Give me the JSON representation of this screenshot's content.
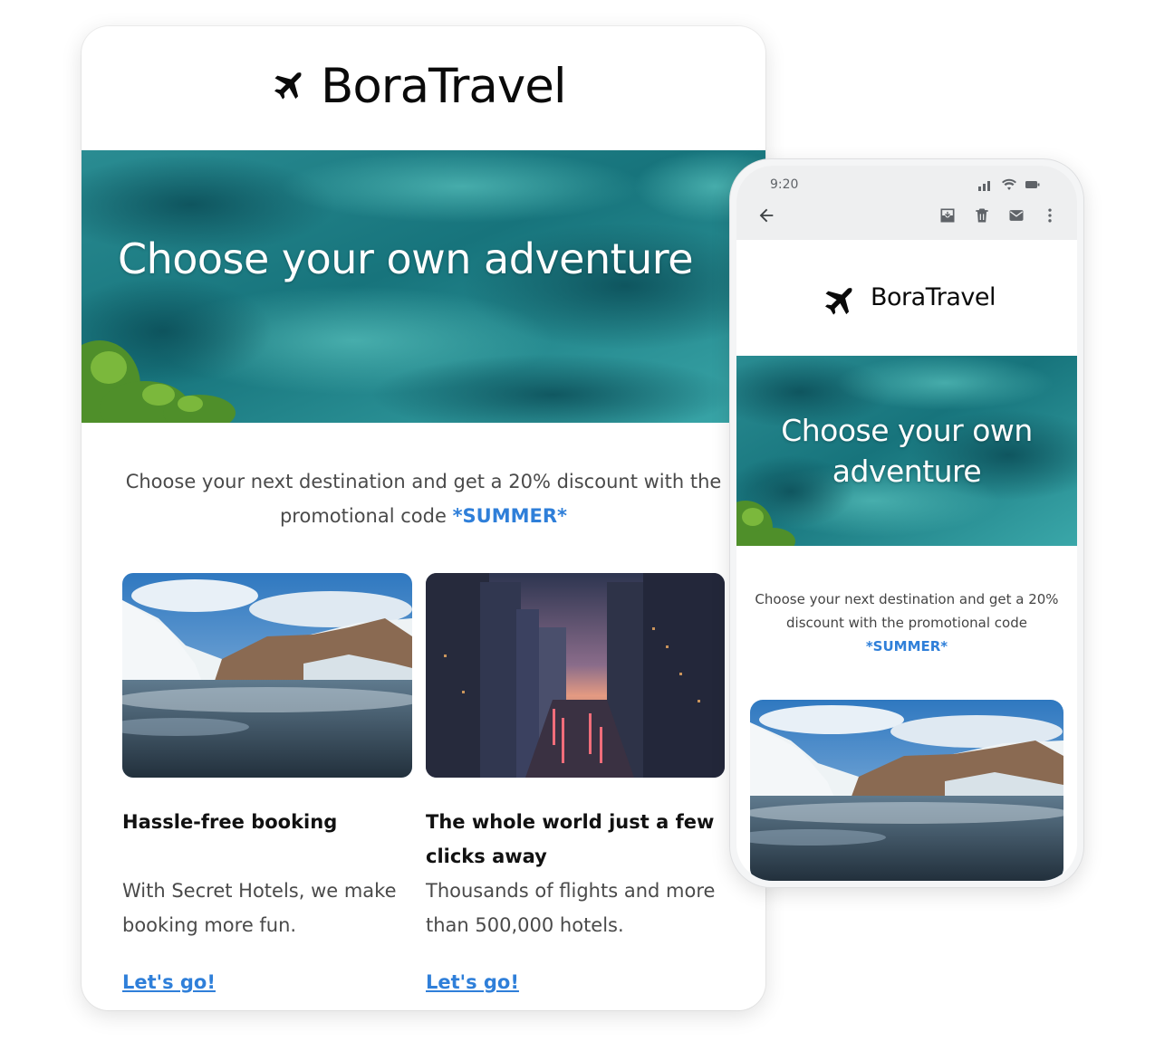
{
  "desktop": {
    "brand": {
      "name": "BoraTravel",
      "icon": "airplane-icon"
    },
    "hero": {
      "title": "Choose your own adventure"
    },
    "intro": {
      "text": "Choose your next destination and get a 20% discount with the promotional code ",
      "promo_code": "*SUMMER*"
    },
    "cards": [
      {
        "image": "glacier-lake-photo",
        "title": "Hassle-free booking",
        "description": "With Secret Hotels, we make booking more fun.",
        "cta": "Let's go!"
      },
      {
        "image": "city-sunset-photo",
        "title": "The whole world just a few clicks away",
        "description": "Thousands of flights and more than 500,000 hotels.",
        "cta": "Let's go!"
      }
    ]
  },
  "phone": {
    "status": {
      "time": "9:20",
      "icons": [
        "signal-icon",
        "wifi-icon",
        "battery-icon"
      ]
    },
    "toolbar": {
      "icons": [
        "back-arrow-icon",
        "archive-icon",
        "trash-icon",
        "mail-icon",
        "more-vert-icon"
      ]
    },
    "brand": {
      "name": "BoraTravel",
      "icon": "airplane-icon"
    },
    "hero": {
      "title": "Choose your own adventure"
    },
    "intro": {
      "text": "Choose your next destination and get a 20% discount with the promotional code ",
      "promo_code": "*SUMMER*"
    },
    "card_image": "glacier-lake-photo"
  },
  "colors": {
    "promo": "#2f7fd9",
    "sea": "#1a7f86",
    "text_muted": "#4a4a4a"
  }
}
